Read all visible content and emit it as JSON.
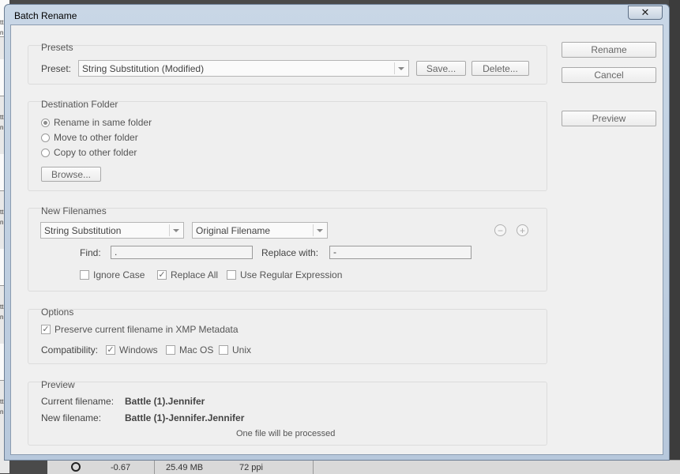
{
  "dialog": {
    "title": "Batch Rename",
    "close_label": "✕"
  },
  "side_buttons": {
    "rename": "Rename",
    "cancel": "Cancel",
    "preview": "Preview"
  },
  "presets": {
    "title": "Presets",
    "label": "Preset:",
    "value": "String Substitution (Modified)",
    "save_label": "Save...",
    "delete_label": "Delete..."
  },
  "destination": {
    "title": "Destination Folder",
    "options": [
      {
        "label": "Rename in same folder",
        "selected": true
      },
      {
        "label": "Move to other folder",
        "selected": false
      },
      {
        "label": "Copy to other folder",
        "selected": false
      }
    ],
    "browse_label": "Browse..."
  },
  "new_filenames": {
    "title": "New Filenames",
    "type_value": "String Substitution",
    "source_value": "Original Filename",
    "remove_label": "−",
    "add_label": "+",
    "find_label": "Find:",
    "find_value": ".",
    "replace_label": "Replace with:",
    "replace_value": "-",
    "ignore_case": {
      "label": "Ignore Case",
      "checked": false
    },
    "replace_all": {
      "label": "Replace All",
      "checked": true
    },
    "regex": {
      "label": "Use Regular Expression",
      "checked": false
    }
  },
  "options": {
    "title": "Options",
    "preserve": {
      "label": "Preserve current filename in XMP Metadata",
      "checked": true
    },
    "compat_label": "Compatibility:",
    "windows": {
      "label": "Windows",
      "checked": true
    },
    "macos": {
      "label": "Mac OS",
      "checked": false
    },
    "unix": {
      "label": "Unix",
      "checked": false
    }
  },
  "preview": {
    "title": "Preview",
    "current_label": "Current filename:",
    "current_value": "Battle (1).Jennifer",
    "new_label": "New filename:",
    "new_value": "Battle (1)-Jennifer.Jennifer",
    "note": "One file will be processed"
  },
  "background": {
    "left_labels": [
      "ttle",
      "nnif",
      "ttle",
      "nnif",
      "ttle",
      "nnif",
      "ttle",
      "nnif",
      "ttle",
      "nnif",
      "ttle",
      "nnif",
      "ttle",
      "nnif",
      "ttle",
      "nnif"
    ],
    "status_value": "-0.67",
    "status_size": "25.49 MB",
    "status_ppi": "72 ppi"
  }
}
